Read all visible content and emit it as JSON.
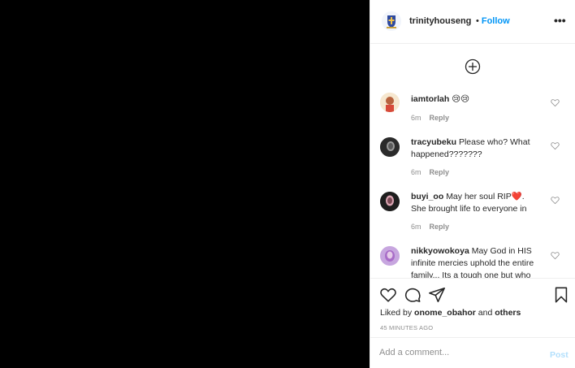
{
  "post": {
    "owner": "trinityhouseng",
    "separator": "•",
    "follow_label": "Follow",
    "more_label": "•••"
  },
  "comments": [
    {
      "user": "iamtorlah",
      "text": "😢😢",
      "time": "6m",
      "reply": "Reply"
    },
    {
      "user": "tracyubeku",
      "text": "Please who? What happened???????",
      "time": "6m",
      "reply": "Reply"
    },
    {
      "user": "buyi_oo",
      "text": "May her soul RIP❤️. She brought life to everyone in",
      "time": "6m",
      "reply": "Reply"
    },
    {
      "user": "nikkyowokoya",
      "text": "May God in HIS infinite mercies uphold the entire family... Its a tough one but who",
      "time": "",
      "reply": ""
    }
  ],
  "likes": {
    "prefix": "Liked by",
    "user": "onome_obahor",
    "and": "and",
    "others": "others"
  },
  "timestamp": "45 MINUTES AGO",
  "add_comment": {
    "placeholder": "Add a comment...",
    "post_label": "Post"
  },
  "colors": {
    "accent": "#0095f6",
    "post_disabled": "#b2dffc",
    "text": "#262626",
    "muted": "#8e8e8e",
    "media_bg": "#000000"
  }
}
